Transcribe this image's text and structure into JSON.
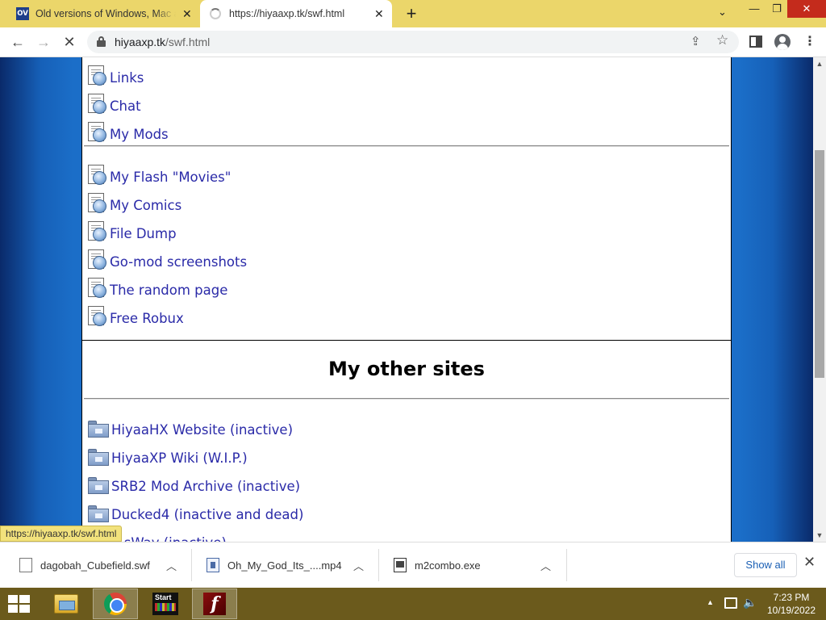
{
  "browser": {
    "tabs": [
      {
        "favicon_text": "OV",
        "title": "Old versions of Windows, Mac and"
      },
      {
        "title": "https://hiyaaxp.tk/swf.html"
      }
    ],
    "address": {
      "host": "hiyaaxp.tk",
      "path": "/swf.html"
    }
  },
  "page": {
    "links_top": [
      "Links",
      "Chat",
      "My Mods"
    ],
    "links_middle": [
      "My Flash \"Movies\"",
      "My Comics",
      "File Dump",
      "Go-mod screenshots",
      "The random page",
      "Free Robux"
    ],
    "section_title": "My other sites",
    "other_sites": [
      "HiyaaHX Website (inactive)",
      "HiyaaXP Wiki (W.I.P.)",
      "SRB2 Mod Archive (inactive)",
      "Ducked4 (inactive and dead)",
      "...sWay (inactive)"
    ]
  },
  "status_url": "https://hiyaaxp.tk/swf.html",
  "downloads": {
    "items": [
      {
        "name": "dagobah_Cubefield.swf",
        "icon": "file-icon"
      },
      {
        "name": "Oh_My_God_Its_....mp4",
        "icon": "video-file-icon"
      },
      {
        "name": "m2combo.exe",
        "icon": "exe-file-icon"
      }
    ],
    "show_all_label": "Show all"
  },
  "taskbar": {
    "apps": [
      "file-explorer",
      "google-chrome",
      "start-app",
      "adobe-flash"
    ],
    "start_app_label": "Start",
    "flash_label": "f",
    "clock": {
      "time": "7:23 PM",
      "date": "10/19/2022"
    }
  }
}
